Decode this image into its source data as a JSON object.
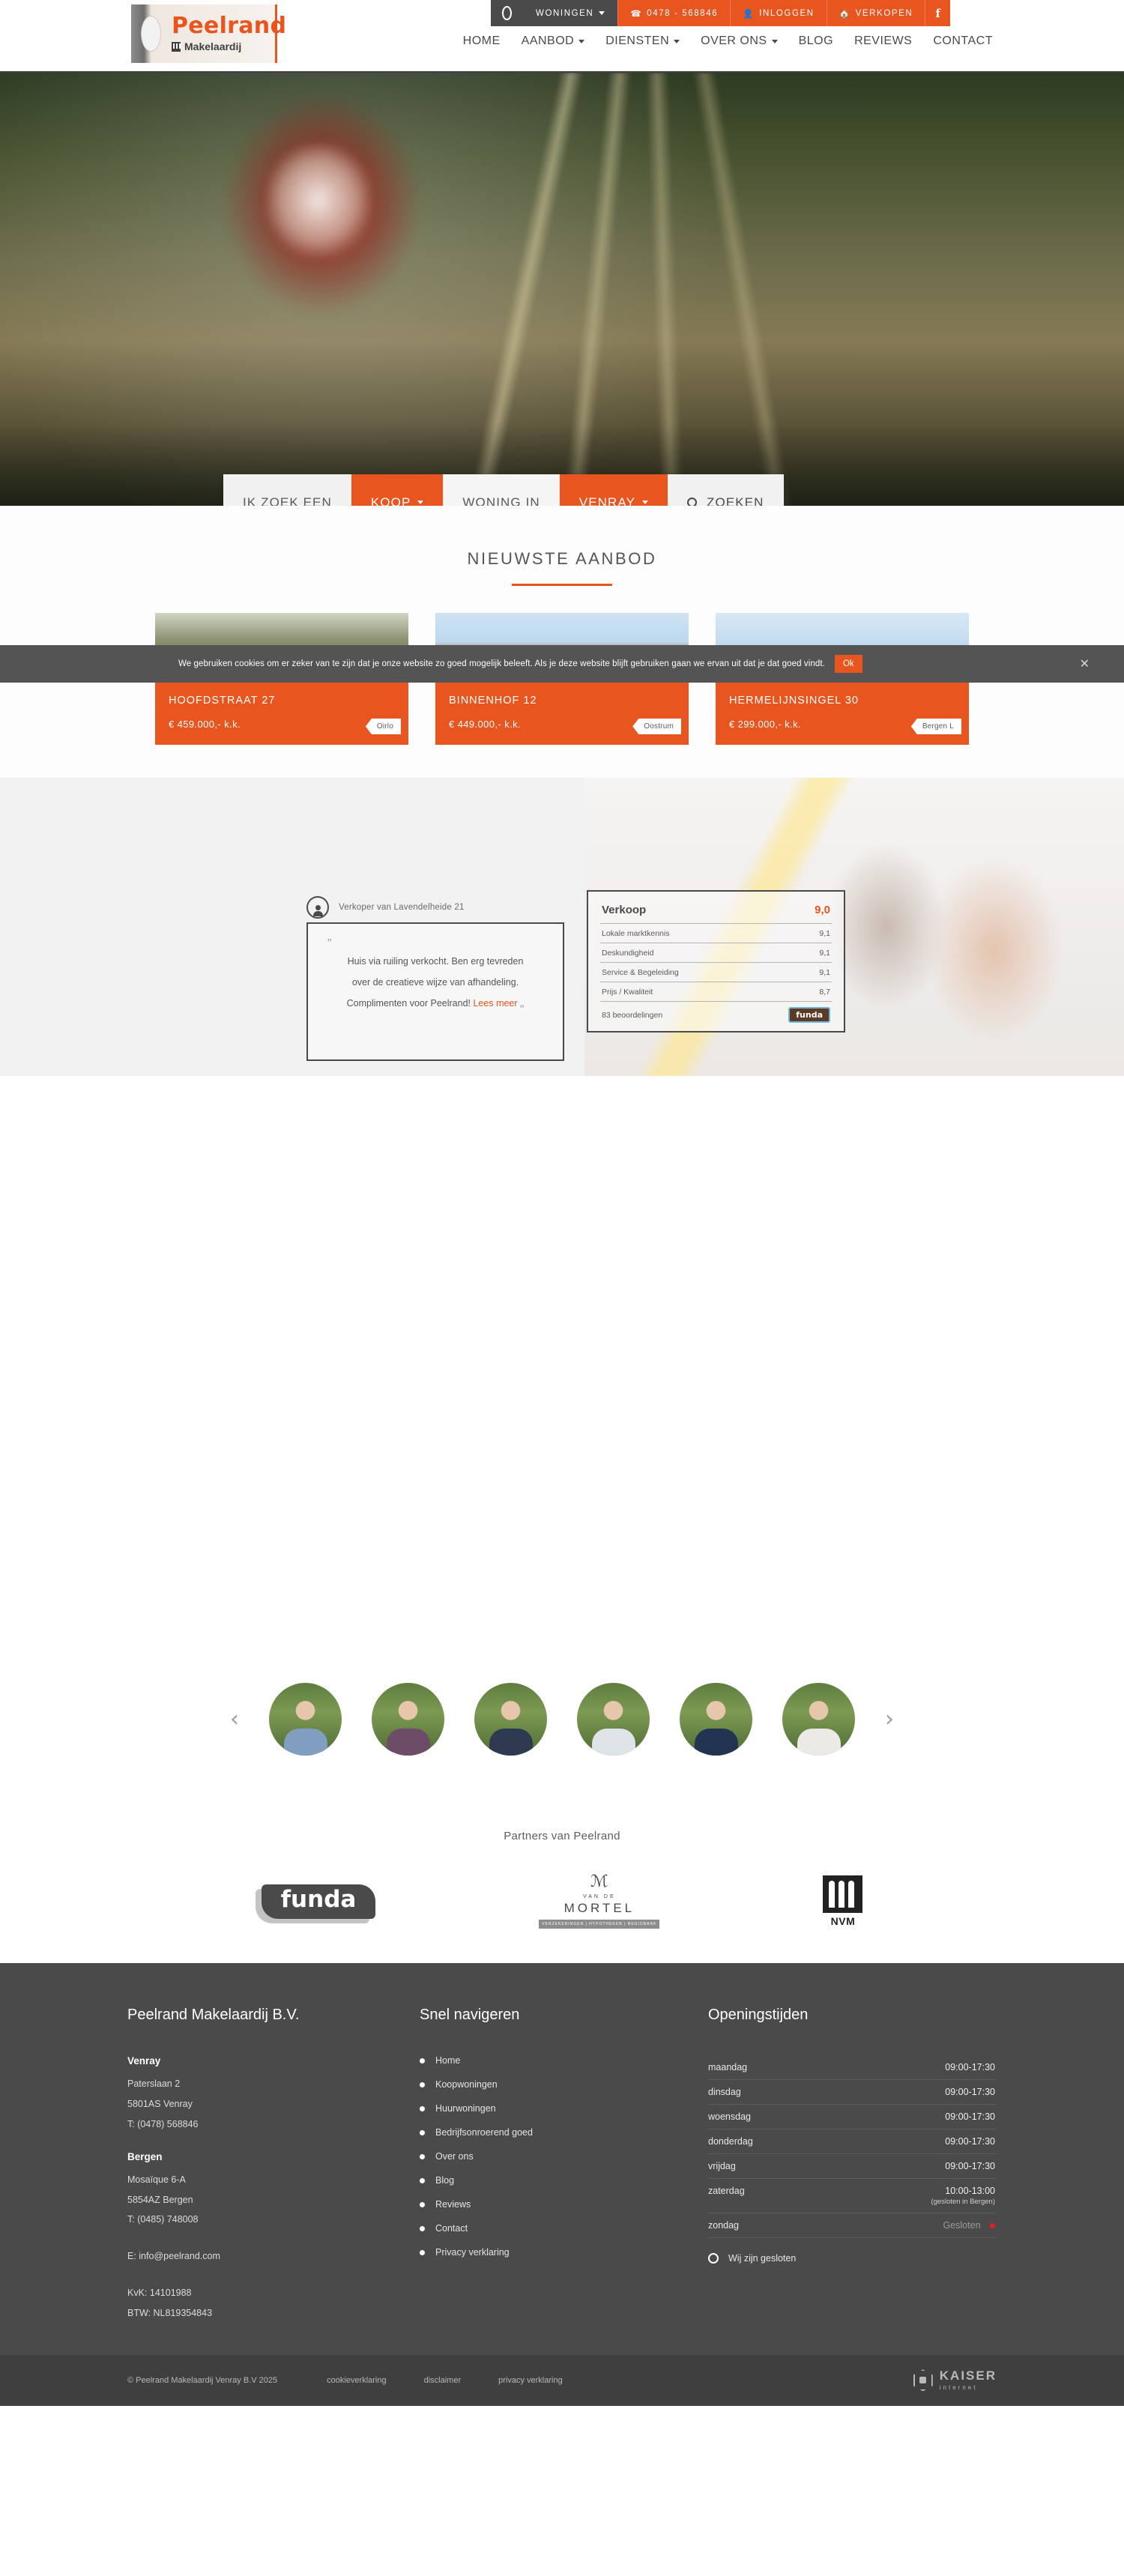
{
  "header": {
    "logo": {
      "title": "Peelrand",
      "subtitle": "Makelaardij"
    },
    "utility": [
      {
        "label": "WONINGEN",
        "icon": "chevron-down-icon",
        "style": "dark"
      },
      {
        "label": "0478 - 568846",
        "icon": "phone-icon",
        "style": "orange"
      },
      {
        "label": "INLOGGEN",
        "icon": "user-icon",
        "style": "orange"
      },
      {
        "label": "VERKOPEN",
        "icon": "house-icon",
        "style": "orange"
      },
      {
        "label": "f",
        "icon": "facebook-icon",
        "style": "orange"
      }
    ],
    "nav": [
      {
        "label": "HOME",
        "caret": false
      },
      {
        "label": "AANBOD",
        "caret": true
      },
      {
        "label": "DIENSTEN",
        "caret": true
      },
      {
        "label": "OVER ONS",
        "caret": true
      },
      {
        "label": "BLOG",
        "caret": false
      },
      {
        "label": "REVIEWS",
        "caret": false
      },
      {
        "label": "CONTACT",
        "caret": false
      }
    ]
  },
  "search": {
    "label": "IK ZOEK EEN",
    "type": "KOOP",
    "middle": "WONING IN",
    "place": "VENRAY",
    "button": "ZOEKEN"
  },
  "listings": {
    "title": "NIEUWSTE AANBOD",
    "cards": [
      {
        "address": "HOOFDSTRAAT 27",
        "price": "€ 459.000,- k.k.",
        "tag": "Oirlo"
      },
      {
        "address": "BINNENHOF 12",
        "price": "€ 449.000,- k.k.",
        "tag": "Oostrum"
      },
      {
        "address": "HERMELIJNSINGEL 30",
        "price": "€ 299.000,- k.k.",
        "tag": "Bergen L"
      }
    ]
  },
  "cookie": {
    "text": "We gebruiken cookies om er zeker van te zijn dat je onze website zo goed mogelijk beleeft. Als je deze website blijft gebruiken gaan we ervan uit dat je dat goed vindt.",
    "ok": "Ok",
    "close": "✕"
  },
  "review": {
    "author": "Verkoper van Lavendelheide 21",
    "quote_open": "”",
    "quote_close": "„",
    "line1": "Huis via ruiling verkocht. Ben erg tevreden",
    "line2": "over de creatieve wijze van afhandeling.",
    "line3": "Complimenten voor Peelrand!",
    "link": "Lees meer"
  },
  "funda": {
    "title": "Verkoop",
    "score": "9,0",
    "rows": [
      {
        "label": "Lokale marktkennis",
        "value": "9,1"
      },
      {
        "label": "Deskundigheid",
        "value": "9,1"
      },
      {
        "label": "Service & Begeleiding",
        "value": "9,1"
      },
      {
        "label": "Prijs / Kwaliteit",
        "value": "8,7"
      }
    ],
    "count": "83 beoordelingen",
    "badge": "funda"
  },
  "team": {
    "prev": "‹",
    "next": "›",
    "members": [
      "member-1",
      "member-2",
      "member-3",
      "member-4",
      "member-5",
      "member-6"
    ]
  },
  "partners": {
    "title": "Partners van Peelrand",
    "funda": "funda",
    "mortel": {
      "mark": "ℳ",
      "vande": "VAN DE",
      "name": "MORTEL",
      "tagline": "VERZEKERINGEN | HYPOTHEKEN | REGIOBANK"
    },
    "nvm": "NVM"
  },
  "footer": {
    "company": {
      "heading": "Peelrand Makelaardij B.V.",
      "offices": [
        {
          "city": "Venray",
          "street": "Paterslaan 2",
          "zip": "5801AS Venray",
          "phone": "T: (0478) 568846"
        },
        {
          "city": "Bergen",
          "street": "Mosaïque 6-A",
          "zip": "5854AZ Bergen",
          "phone": "T: (0485) 748008"
        }
      ],
      "email": "E: info@peelrand.com",
      "kvk": "KvK: 14101988",
      "btw": "BTW: NL819354843"
    },
    "nav": {
      "heading": "Snel navigeren",
      "items": [
        "Home",
        "Koopwoningen",
        "Huurwoningen",
        "Bedrijfsonroerend goed",
        "Over ons",
        "Blog",
        "Reviews",
        "Contact",
        "Privacy verklaring"
      ]
    },
    "hours": {
      "heading": "Openingstijden",
      "rows": [
        {
          "day": "maandag",
          "value": "09:00-17:30",
          "note": ""
        },
        {
          "day": "dinsdag",
          "value": "09:00-17:30",
          "note": ""
        },
        {
          "day": "woensdag",
          "value": "09:00-17:30",
          "note": ""
        },
        {
          "day": "donderdag",
          "value": "09:00-17:30",
          "note": ""
        },
        {
          "day": "vrijdag",
          "value": "09:00-17:30",
          "note": ""
        },
        {
          "day": "zaterdag",
          "value": "10:00-13:00",
          "note": "(gesloten in Bergen)"
        },
        {
          "day": "zondag",
          "value": "Gesloten",
          "note": ""
        }
      ],
      "status": "Wij zijn gesloten"
    }
  },
  "bottom": {
    "copyright": "© Peelrand Makelaardij Venray B.V 2025",
    "links": [
      "cookieverklaring",
      "disclaimer",
      "privacy verklaring"
    ],
    "kaiser_1": "KAISER",
    "kaiser_2": "internet"
  },
  "colors": {
    "accent": "#e8551f",
    "dark": "#4a4a4a",
    "darker": "#3f3f3f"
  }
}
